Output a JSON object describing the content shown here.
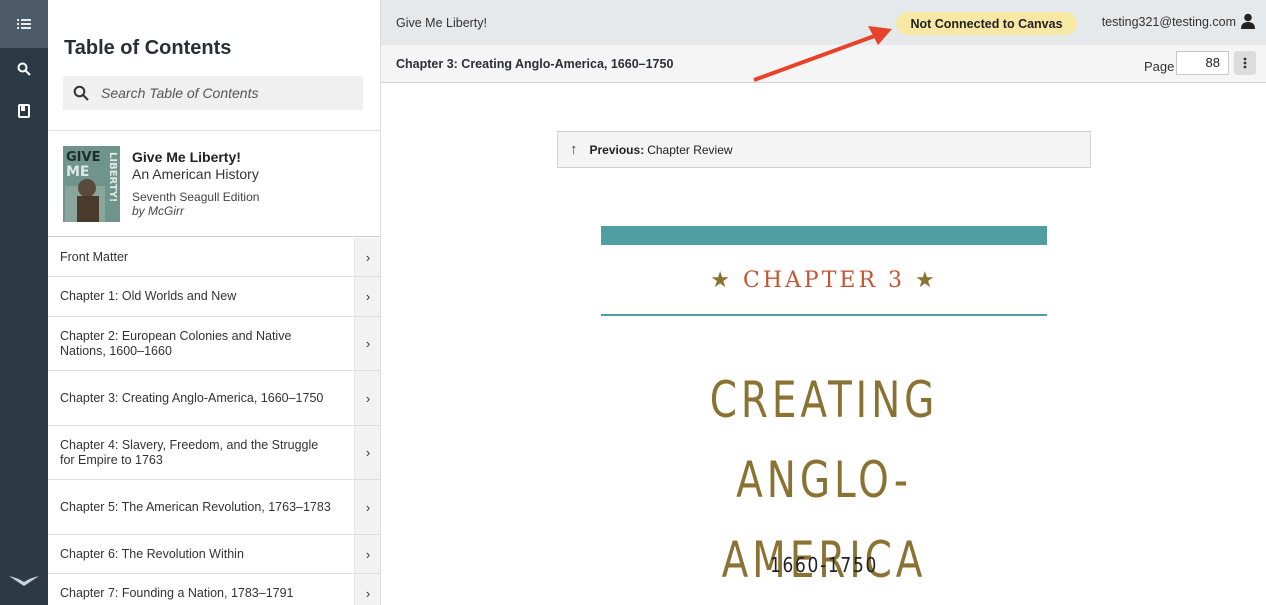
{
  "rail": {
    "items": [
      {
        "icon": "list-icon"
      },
      {
        "icon": "search-icon"
      },
      {
        "icon": "bookmark-icon"
      }
    ],
    "logo_icon": "bird-logo-icon"
  },
  "toc": {
    "title": "Table of Contents",
    "search_placeholder": "Search Table of Contents",
    "book": {
      "title": "Give Me Liberty!",
      "subtitle": "An American History",
      "edition": "Seventh Seagull Edition",
      "author": "by McGirr",
      "cover_text": "GIVE ME LIBERTY!"
    },
    "items": [
      {
        "label": "Front Matter"
      },
      {
        "label": "Chapter 1: Old Worlds and New"
      },
      {
        "label": "Chapter 2: European Colonies and Native Nations, 1600–1660"
      },
      {
        "label": "Chapter 3: Creating Anglo-America, 1660–1750"
      },
      {
        "label": "Chapter 4: Slavery, Freedom, and the Struggle for Empire to 1763"
      },
      {
        "label": "Chapter 5: The American Revolution, 1763–1783"
      },
      {
        "label": "Chapter 6: The Revolution Within"
      },
      {
        "label": "Chapter 7: Founding a Nation, 1783–1791"
      }
    ]
  },
  "topbar": {
    "book_name": "Give Me Liberty!",
    "canvas_status": "Not Connected to Canvas",
    "user_email": "testing321@testing.com"
  },
  "chapbar": {
    "chapter_name": "Chapter 3: Creating Anglo-America, 1660–1750",
    "page_label": "Page",
    "page_value": "88"
  },
  "content": {
    "prev_label": "Previous:",
    "prev_target": "Chapter Review",
    "chapter_label": "CHAPTER 3",
    "title_line1": "CREATING ANGLO-",
    "title_line2": "AMERICA",
    "years": "1660-1750"
  },
  "colors": {
    "rail": "#2c3a45",
    "badge": "#f8e8a5",
    "teal": "#4e9ea3",
    "chapter_red": "#c35434",
    "title_gold": "#8a7232",
    "arrow_red": "#e8432a"
  }
}
